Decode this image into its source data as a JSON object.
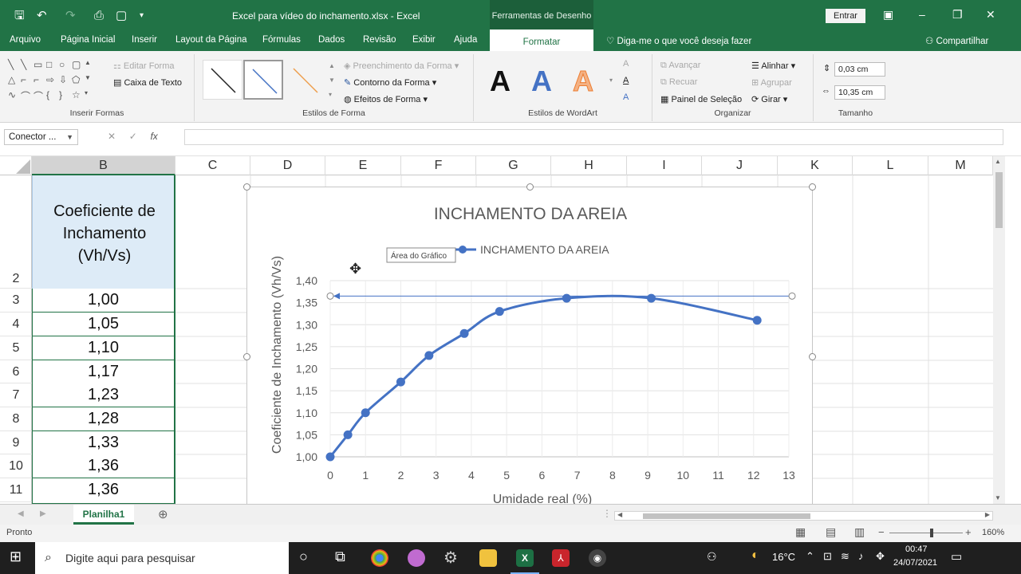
{
  "window": {
    "title": "Excel para vídeo do inchamento.xlsx  -  Excel",
    "context_tools": "Ferramentas de Desenho",
    "signin": "Entrar"
  },
  "tabs": [
    "Arquivo",
    "Página Inicial",
    "Inserir",
    "Layout da Página",
    "Fórmulas",
    "Dados",
    "Revisão",
    "Exibir",
    "Ajuda",
    "Formatar"
  ],
  "tellme": "Diga-me o que você deseja fazer",
  "share": "Compartilhar",
  "ribbon": {
    "insert_shapes": {
      "label": "Inserir Formas",
      "edit_shape": "Editar Forma",
      "text_box": "Caixa de Texto"
    },
    "shape_styles": {
      "label": "Estilos de Forma",
      "fill": "Preenchimento da Forma",
      "outline": "Contorno da Forma",
      "effects": "Efeitos de Forma"
    },
    "wordart": {
      "label": "Estilos de WordArt",
      "letter": "A"
    },
    "arrange": {
      "label": "Organizar",
      "bring_forward": "Avançar",
      "send_backward": "Recuar",
      "selection_pane": "Painel de Seleção",
      "align": "Alinhar",
      "group": "Agrupar",
      "rotate": "Girar"
    },
    "size": {
      "label": "Tamanho",
      "height": "0,03 cm",
      "width": "10,35 cm"
    }
  },
  "formula_bar": {
    "name_box": "Conector ...",
    "fx": "fx"
  },
  "columns": [
    "B",
    "C",
    "D",
    "E",
    "F",
    "G",
    "H",
    "I",
    "J",
    "K",
    "L",
    "M"
  ],
  "rows": [
    "2",
    "3",
    "4",
    "5",
    "6",
    "7",
    "8",
    "9",
    "10",
    "11"
  ],
  "cells": {
    "header": [
      "Coeficiente de",
      "Inchamento",
      "(Vh/Vs)"
    ],
    "values": [
      "1,00",
      "1,05",
      "1,10",
      "1,17",
      "1,23",
      "1,28",
      "1,33",
      "1,36",
      "1,36"
    ]
  },
  "chart_tooltip": "Área do Gráfico",
  "chart_data": {
    "type": "line",
    "title": "INCHAMENTO DA AREIA",
    "xlabel": "Umidade real (%)",
    "ylabel": "Coeficiente de Inchamento (Vh/Vs)",
    "xlim": [
      0,
      13
    ],
    "ylim": [
      1.0,
      1.4
    ],
    "xticks": [
      "0",
      "1",
      "2",
      "3",
      "4",
      "5",
      "6",
      "7",
      "8",
      "9",
      "10",
      "11",
      "12",
      "13"
    ],
    "yticks": [
      "1,00",
      "1,05",
      "1,10",
      "1,15",
      "1,20",
      "1,25",
      "1,30",
      "1,35",
      "1,40"
    ],
    "grid": true,
    "legend": "top-center",
    "series": [
      {
        "name": "INCHAMENTO DA AREIA",
        "color": "#4472c4",
        "x": [
          0,
          0.5,
          1,
          2,
          2.8,
          3.8,
          4.8,
          6.7,
          9.1,
          12.1
        ],
        "y": [
          1.0,
          1.05,
          1.1,
          1.17,
          1.23,
          1.28,
          1.33,
          1.36,
          1.36,
          1.31
        ]
      }
    ],
    "connector_line_y": 1.365
  },
  "sheet": {
    "tab": "Planilha1"
  },
  "status": {
    "ready": "Pronto",
    "zoom": "160%"
  },
  "taskbar": {
    "search_placeholder": "Digite aqui para pesquisar",
    "temp": "16°C",
    "time": "00:47",
    "date": "24/07/2021"
  },
  "colors": {
    "excel_green": "#217346",
    "series": "#4472c4"
  }
}
